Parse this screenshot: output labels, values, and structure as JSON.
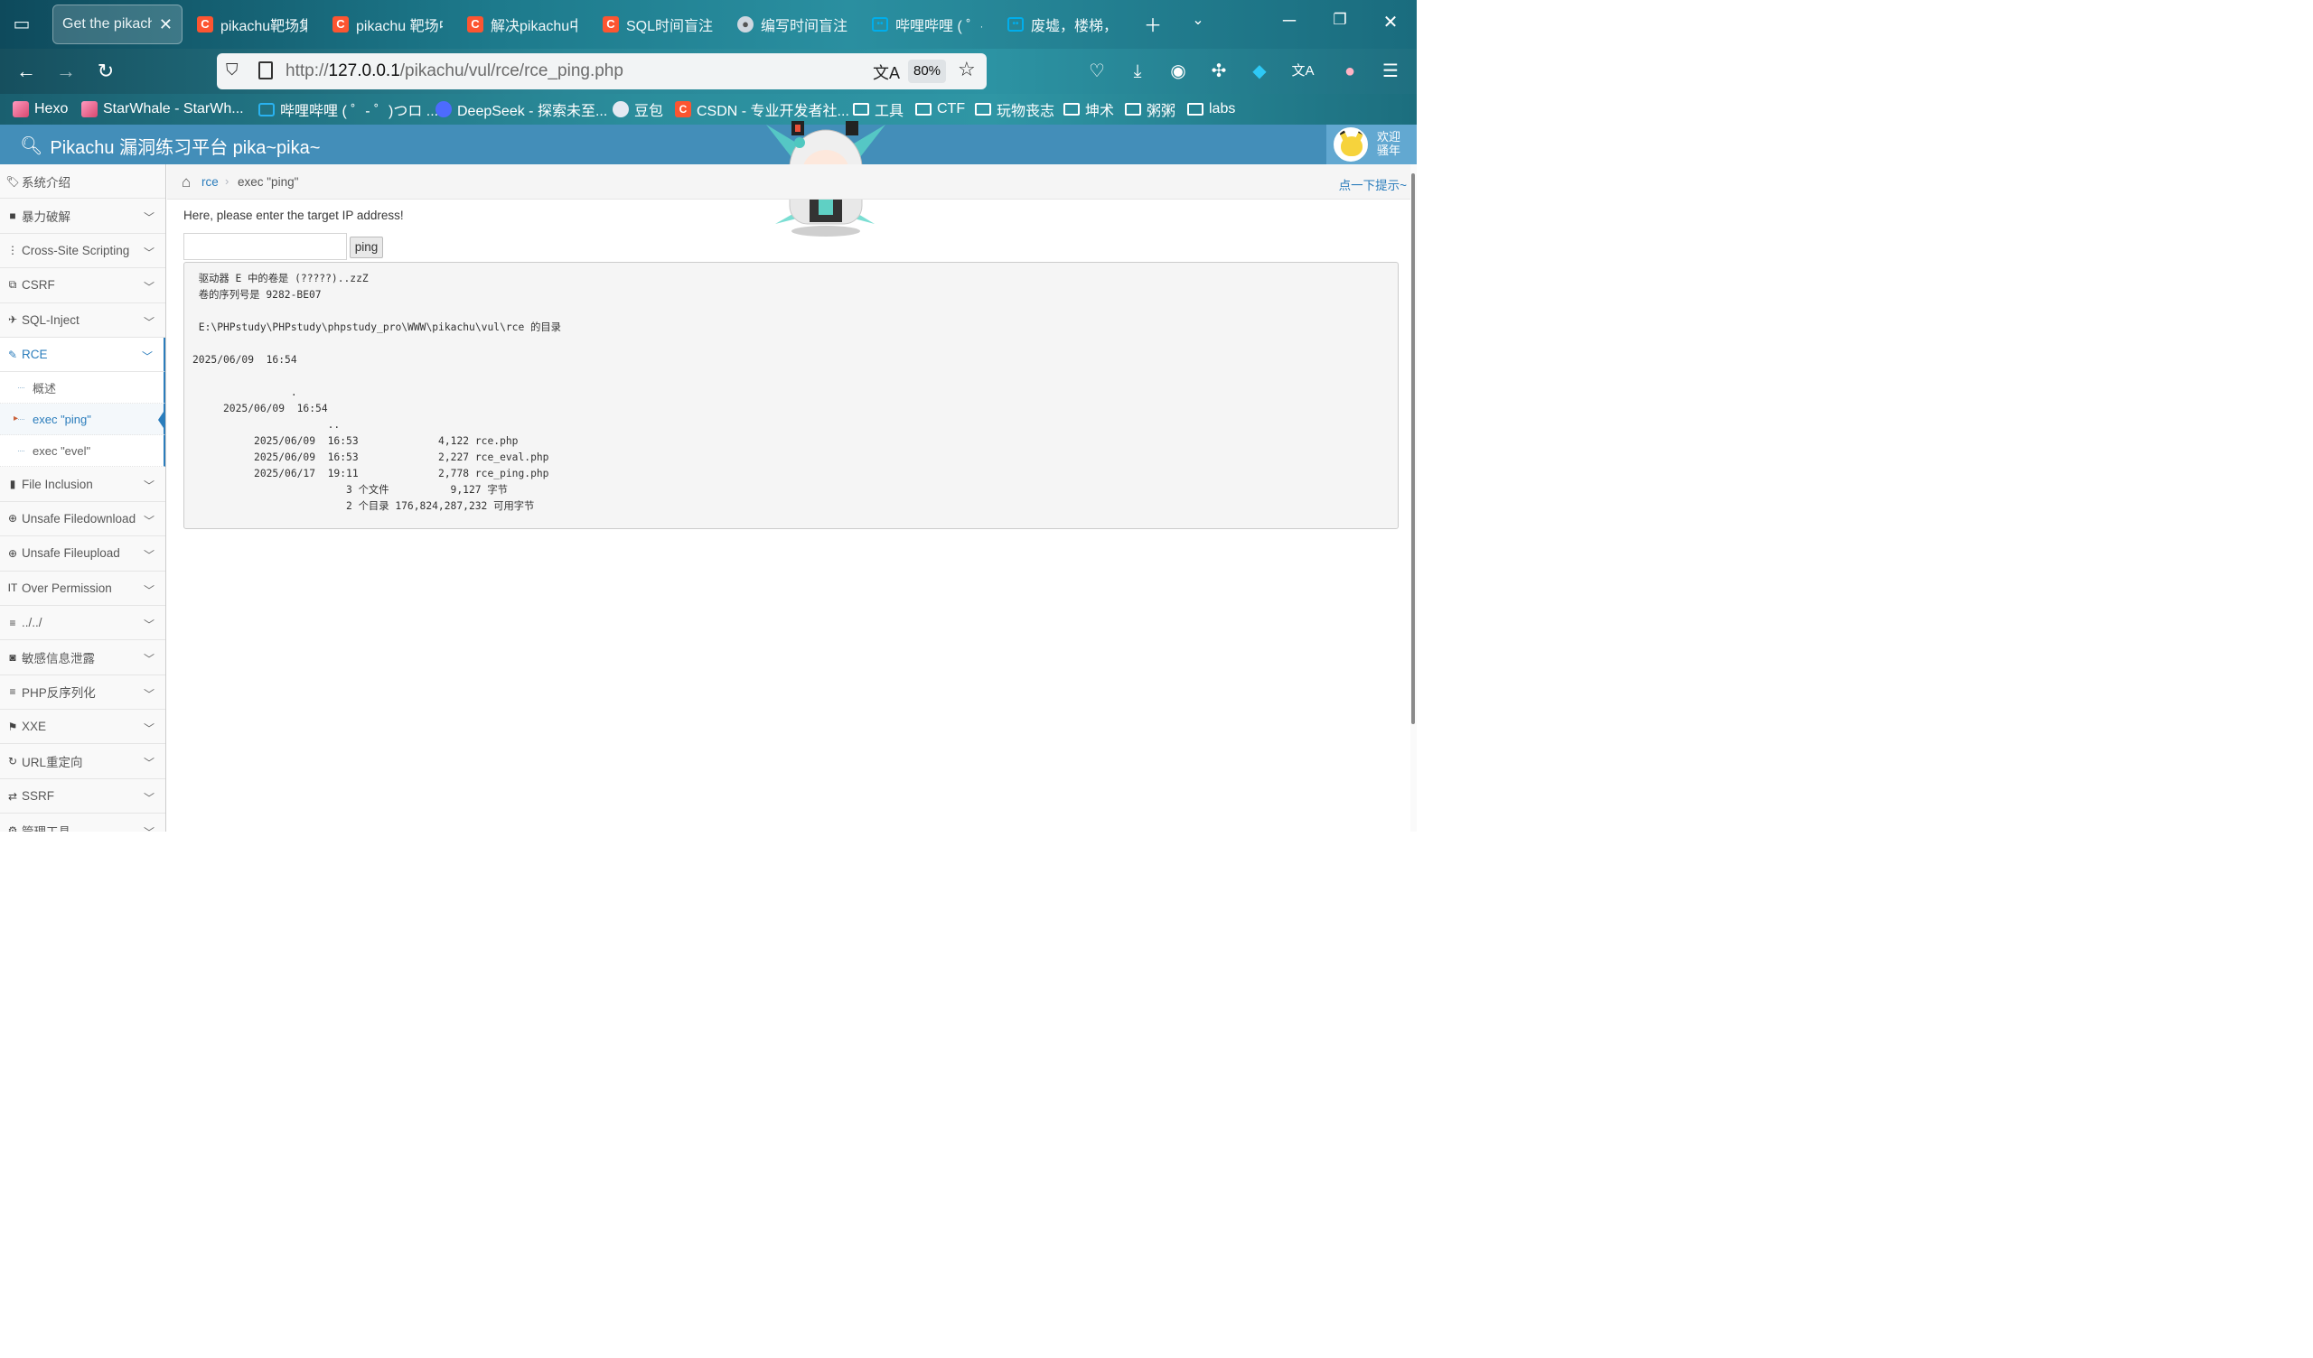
{
  "browser": {
    "tabs": [
      {
        "label": "Get the pikachu",
        "icon": "none",
        "active": true
      },
      {
        "label": "pikachu靶场集",
        "icon": "csdn"
      },
      {
        "label": "pikachu 靶场中",
        "icon": "csdn"
      },
      {
        "label": "解决pikachu中",
        "icon": "csdn"
      },
      {
        "label": "SQL时间盲注p",
        "icon": "csdn"
      },
      {
        "label": "编写时间盲注脚",
        "icon": "avatar"
      },
      {
        "label": "哔哩哔哩 ( ゜-",
        "icon": "bilibili"
      },
      {
        "label": "废墟，楼梯，",
        "icon": "bilibili"
      }
    ],
    "url_prefix": "http://",
    "url_host": "127.0.0.1",
    "url_path": "/pikachu/vul/rce/rce_ping.php",
    "zoom": "80%",
    "bookmarks": [
      {
        "label": "Hexo",
        "icon": "pink"
      },
      {
        "label": "StarWhale - StarWh...",
        "icon": "pink"
      },
      {
        "label": "哔哩哔哩 ( ゜- ゜)つロ ...",
        "icon": "blue"
      },
      {
        "label": "DeepSeek - 探索未至...",
        "icon": "ds"
      },
      {
        "label": "豆包",
        "icon": "doubao"
      },
      {
        "label": "CSDN - 专业开发者社...",
        "icon": "csdn"
      },
      {
        "label": "工具",
        "icon": "folder"
      },
      {
        "label": "CTF",
        "icon": "folder"
      },
      {
        "label": "玩物丧志",
        "icon": "folder"
      },
      {
        "label": "坤术",
        "icon": "folder"
      },
      {
        "label": "粥粥",
        "icon": "folder"
      },
      {
        "label": "labs",
        "icon": "folder"
      }
    ]
  },
  "header": {
    "brand": "Pikachu 漏洞练习平台 pika~pika~",
    "welcome_line1": "欢迎",
    "welcome_line2": "骚年"
  },
  "sidebar": {
    "items": [
      {
        "label": "系统介绍",
        "icon": "tags-icon",
        "chevron": false
      },
      {
        "label": "暴力破解",
        "icon": "lock-icon",
        "chevron": true
      },
      {
        "label": "Cross-Site Scripting",
        "icon": "sitemap-icon",
        "chevron": true
      },
      {
        "label": "CSRF",
        "icon": "share-icon",
        "chevron": true
      },
      {
        "label": "SQL-Inject",
        "icon": "fighter-jet-icon",
        "chevron": true
      },
      {
        "label": "RCE",
        "icon": "pencil-icon",
        "chevron": true,
        "open": true
      },
      {
        "label": "File Inclusion",
        "icon": "file-icon",
        "chevron": true
      },
      {
        "label": "Unsafe Filedownload",
        "icon": "download-icon",
        "chevron": true
      },
      {
        "label": "Unsafe Fileupload",
        "icon": "upload-icon",
        "chevron": true
      },
      {
        "label": "Over Permission",
        "icon": "text-height-icon",
        "chevron": true
      },
      {
        "label": "../../",
        "icon": "align-left-icon",
        "chevron": true
      },
      {
        "label": "敏感信息泄露",
        "icon": "camera-icon",
        "chevron": true
      },
      {
        "label": "PHP反序列化",
        "icon": "align-left-icon",
        "chevron": true
      },
      {
        "label": "XXE",
        "icon": "flag-icon",
        "chevron": true
      },
      {
        "label": "URL重定向",
        "icon": "refresh-icon",
        "chevron": true
      },
      {
        "label": "SSRF",
        "icon": "exchange-icon",
        "chevron": true
      },
      {
        "label": "管理工具",
        "icon": "cog-icon",
        "chevron": true
      }
    ],
    "rce_sub": [
      "概述",
      "exec \"ping\"",
      "exec \"evel\""
    ]
  },
  "breadcrumb": {
    "parent": "rce",
    "current": "exec \"ping\"",
    "hint": "点一下提示~"
  },
  "main": {
    "prompt": "Here, please enter the target IP address!",
    "input_value": "",
    "button_label": "ping",
    "output": " 驱动器 E 中的卷是 (?????)..zzZ\n 卷的序列号是 9282-BE07\n\n E:\\PHPstudy\\PHPstudy\\phpstudy_pro\\WWW\\pikachu\\vul\\rce 的目录\n\n2025/06/09  16:54\n\n                .\n     2025/06/09  16:54\n                      ..\n          2025/06/09  16:53             4,122 rce.php\n          2025/06/09  16:53             2,227 rce_eval.php\n          2025/06/17  19:11             2,778 rce_ping.php\n                         3 个文件          9,127 字节\n                         2 个目录 176,824,287,232 可用字节"
  },
  "colors": {
    "header_bg": "#438eb9",
    "link": "#2b7dbc",
    "user_box": "#62a8d1"
  }
}
